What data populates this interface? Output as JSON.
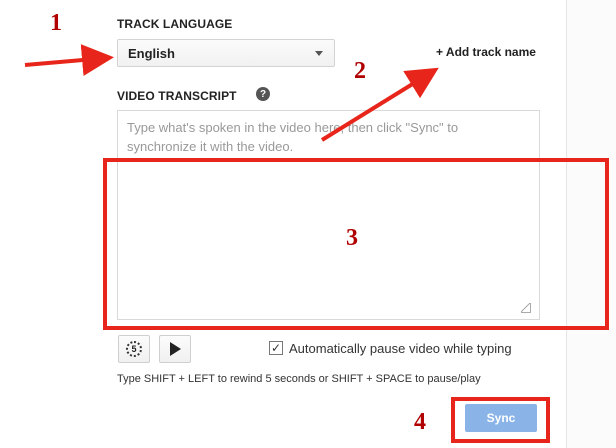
{
  "track_language": {
    "heading": "TRACK LANGUAGE",
    "selected": "English",
    "add_track_name": "+ Add track name"
  },
  "transcript": {
    "heading": "VIDEO TRANSCRIPT",
    "help_icon": "?",
    "placeholder": "Type what's spoken in the video here, then click \"Sync\" to synchronize it with the video."
  },
  "controls": {
    "rewind_label": "5",
    "autopause_checked": true,
    "autopause_label": "Automatically pause video while typing",
    "check_mark": "✓",
    "hint": "Type SHIFT + LEFT to rewind 5 seconds or SHIFT + SPACE to pause/play"
  },
  "sync_button": "Sync",
  "annotations": {
    "n1": "1",
    "n2": "2",
    "n3": "3",
    "n4": "4",
    "color": "#e8251b"
  },
  "icons": [
    "help-icon",
    "rewind-5-icon",
    "play-icon",
    "dropdown-caret-icon",
    "resize-grip-icon",
    "checkbox-check-icon"
  ]
}
